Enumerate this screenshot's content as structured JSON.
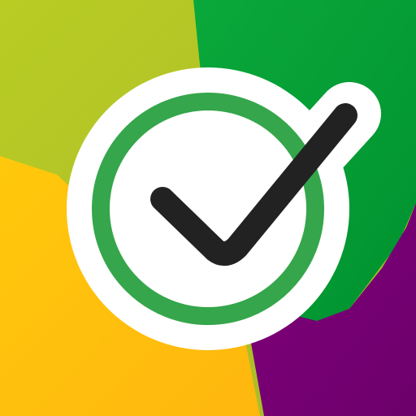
{
  "icon": {
    "name": "checkmark-app-icon",
    "colors": {
      "lime": "#b3c526",
      "green": "#00a13a",
      "yellow": "#ffc20e",
      "purple": "#7a0074",
      "ring": "#35a64b",
      "check": "#222222",
      "outline": "#ffffff"
    }
  }
}
